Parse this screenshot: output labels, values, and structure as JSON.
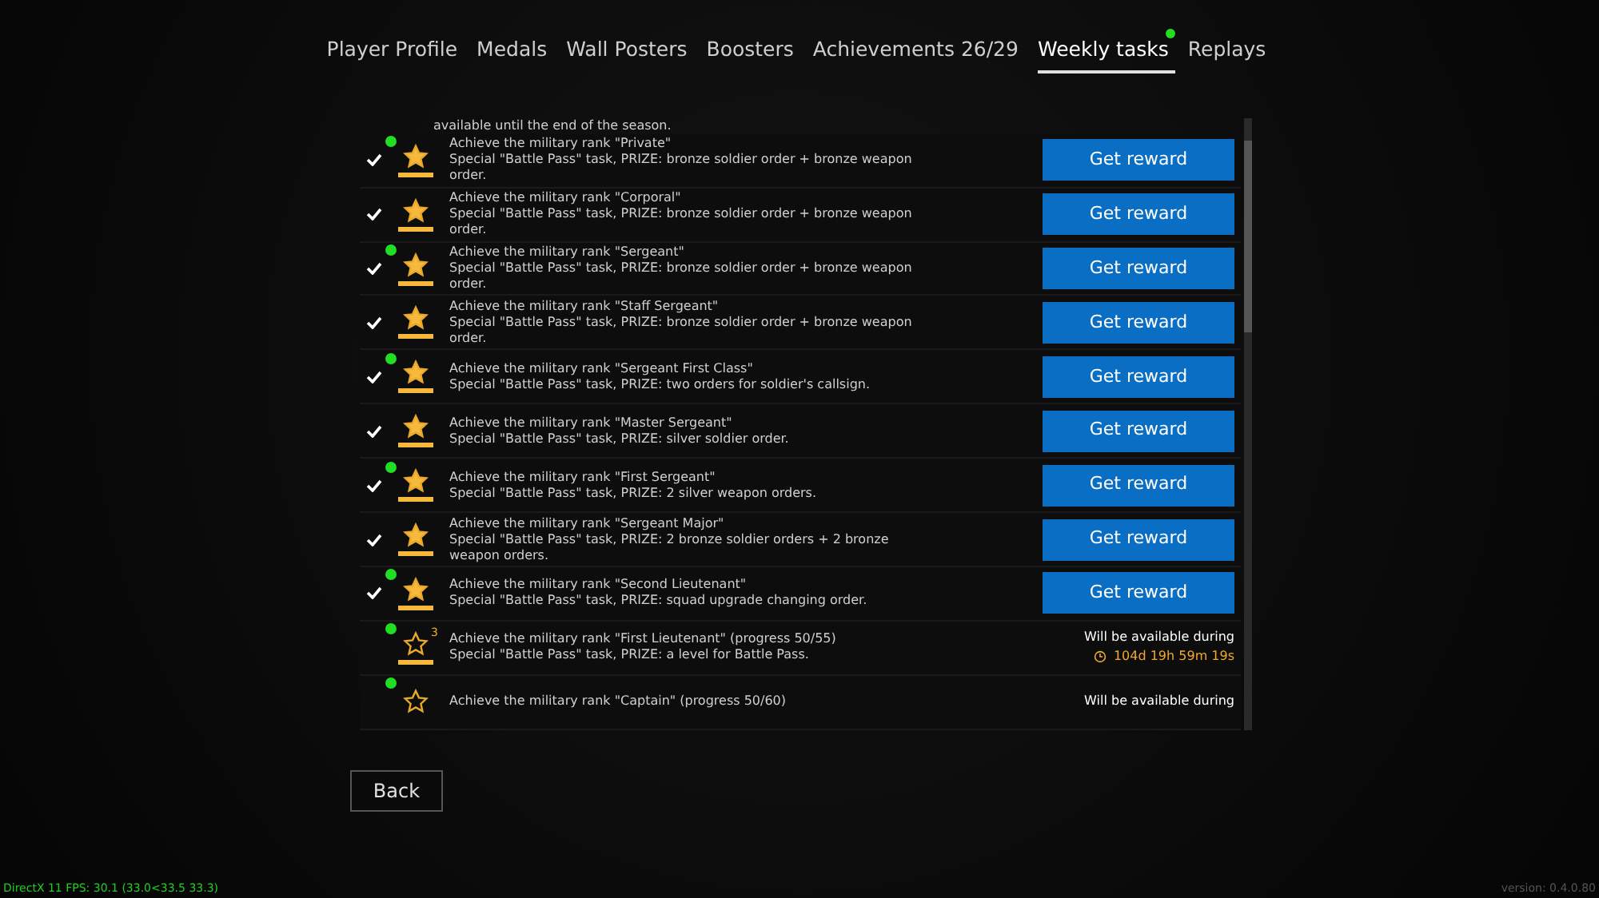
{
  "tabs": [
    {
      "label": "Player Profile",
      "selected": false,
      "badge": false
    },
    {
      "label": "Medals",
      "selected": false,
      "badge": false
    },
    {
      "label": "Wall Posters",
      "selected": false,
      "badge": false
    },
    {
      "label": "Boosters",
      "selected": false,
      "badge": false
    },
    {
      "label": "Achievements 26/29",
      "selected": false,
      "badge": false
    },
    {
      "label": "Weekly tasks",
      "selected": true,
      "badge": true
    },
    {
      "label": "Replays",
      "selected": false,
      "badge": false
    }
  ],
  "list_top_text": "available until the end of the season.",
  "tasks": [
    {
      "kind": "claimable",
      "done": true,
      "new": true,
      "title": "Achieve the military rank \"Private\"",
      "description": "Special \"Battle Pass\" task, PRIZE: bronze soldier order + bronze weapon order.",
      "button": "Get reward"
    },
    {
      "kind": "claimable",
      "done": true,
      "new": false,
      "title": "Achieve the military rank \"Corporal\"",
      "description": "Special \"Battle Pass\" task, PRIZE: bronze soldier order + bronze weapon order.",
      "button": "Get reward"
    },
    {
      "kind": "claimable",
      "done": true,
      "new": true,
      "title": "Achieve the military rank \"Sergeant\"",
      "description": "Special \"Battle Pass\" task, PRIZE: bronze soldier order + bronze weapon order.",
      "button": "Get reward"
    },
    {
      "kind": "claimable",
      "done": true,
      "new": false,
      "title": "Achieve the military rank \"Staff Sergeant\"",
      "description": "Special \"Battle Pass\" task, PRIZE: bronze soldier order + bronze weapon order.",
      "button": "Get reward"
    },
    {
      "kind": "claimable",
      "done": true,
      "new": true,
      "title": "Achieve the military rank \"Sergeant First Class\"",
      "description": "Special \"Battle Pass\" task, PRIZE: two orders for soldier's callsign.",
      "button": "Get reward"
    },
    {
      "kind": "claimable",
      "done": true,
      "new": false,
      "title": "Achieve the military rank \"Master Sergeant\"",
      "description": "Special \"Battle Pass\" task, PRIZE: silver soldier order.",
      "button": "Get reward"
    },
    {
      "kind": "claimable",
      "done": true,
      "new": true,
      "title": "Achieve the military rank \"First Sergeant\"",
      "description": "Special \"Battle Pass\" task, PRIZE: 2 silver weapon orders.",
      "button": "Get reward"
    },
    {
      "kind": "claimable",
      "done": true,
      "new": false,
      "title": "Achieve the military rank \"Sergeant Major\"",
      "description": "Special \"Battle Pass\" task, PRIZE: 2 bronze soldier orders + 2 bronze weapon orders.",
      "button": "Get reward"
    },
    {
      "kind": "claimable",
      "done": true,
      "new": true,
      "title": "Achieve the military rank \"Second Lieutenant\"",
      "description": "Special \"Battle Pass\" task, PRIZE: squad upgrade changing order.",
      "button": "Get reward"
    },
    {
      "kind": "pending",
      "done": false,
      "new": true,
      "star_count": "3",
      "title": "Achieve the military rank \"First Lieutenant\" (progress 50/55)",
      "description": "Special \"Battle Pass\" task, PRIZE: a level for Battle Pass.",
      "availability": "Will be available during",
      "timer": "104d 19h 59m 19s"
    },
    {
      "kind": "pending",
      "done": false,
      "new": true,
      "title": "Achieve the military rank \"Captain\" (progress 50/60)",
      "availability": "Will be available during"
    }
  ],
  "back_button": "Back",
  "status_text": "DirectX 11 FPS: 30.1 (33.0<33.5 33.3)",
  "version": "version: 0.4.0.80"
}
